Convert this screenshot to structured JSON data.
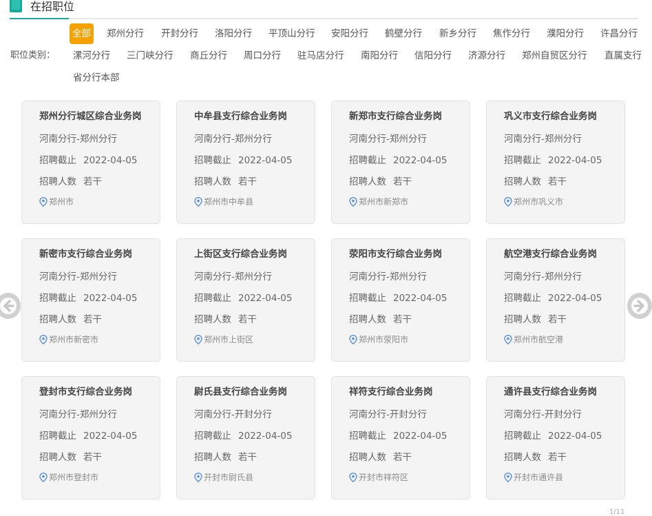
{
  "header": {
    "title": "在招职位"
  },
  "filters": {
    "category_label": "职位类别：",
    "items": [
      "全部",
      "郑州分行",
      "开封分行",
      "洛阳分行",
      "平顶山分行",
      "安阳分行",
      "鹤壁分行",
      "新乡分行",
      "焦作分行",
      "濮阳分行",
      "许昌分行",
      "漯河分行",
      "三门峡分行",
      "商丘分行",
      "周口分行",
      "驻马店分行",
      "南阳分行",
      "信阳分行",
      "济源分行",
      "郑州自贸区分行",
      "直属支行",
      "省分行本部"
    ],
    "active": "全部"
  },
  "labels": {
    "deadline": "招聘截止",
    "headcount": "招聘人数"
  },
  "jobs": [
    {
      "title": "郑州分行城区综合业务岗",
      "org": "河南分行-郑州分行",
      "deadline": "2022-04-05",
      "headcount": "若干",
      "location": "郑州市"
    },
    {
      "title": "中牟县支行综合业务岗",
      "org": "河南分行-郑州分行",
      "deadline": "2022-04-05",
      "headcount": "若干",
      "location": "郑州市中牟县"
    },
    {
      "title": "新郑市支行综合业务岗",
      "org": "河南分行-郑州分行",
      "deadline": "2022-04-05",
      "headcount": "若干",
      "location": "郑州市新郑市"
    },
    {
      "title": "巩义市支行综合业务岗",
      "org": "河南分行-郑州分行",
      "deadline": "2022-04-05",
      "headcount": "若干",
      "location": "郑州市巩义市"
    },
    {
      "title": "新密市支行综合业务岗",
      "org": "河南分行-郑州分行",
      "deadline": "2022-04-05",
      "headcount": "若干",
      "location": "郑州市新密市"
    },
    {
      "title": "上街区支行综合业务岗",
      "org": "河南分行-郑州分行",
      "deadline": "2022-04-05",
      "headcount": "若干",
      "location": "郑州市上街区"
    },
    {
      "title": "荥阳市支行综合业务岗",
      "org": "河南分行-郑州分行",
      "deadline": "2022-04-05",
      "headcount": "若干",
      "location": "郑州市荥阳市"
    },
    {
      "title": "航空港支行综合业务岗",
      "org": "河南分行-郑州分行",
      "deadline": "2022-04-05",
      "headcount": "若干",
      "location": "郑州市航空港"
    },
    {
      "title": "登封市支行综合业务岗",
      "org": "河南分行-郑州分行",
      "deadline": "2022-04-05",
      "headcount": "若干",
      "location": "郑州市登封市"
    },
    {
      "title": "尉氏县支行综合业务岗",
      "org": "河南分行-开封分行",
      "deadline": "2022-04-05",
      "headcount": "若干",
      "location": "开封市尉氏县"
    },
    {
      "title": "祥符支行综合业务岗",
      "org": "河南分行-开封分行",
      "deadline": "2022-04-05",
      "headcount": "若干",
      "location": "开封市祥符区"
    },
    {
      "title": "通许县支行综合业务岗",
      "org": "河南分行-开封分行",
      "deadline": "2022-04-05",
      "headcount": "若干",
      "location": "开封市通许县"
    }
  ],
  "pagination": {
    "text": "1/11"
  }
}
